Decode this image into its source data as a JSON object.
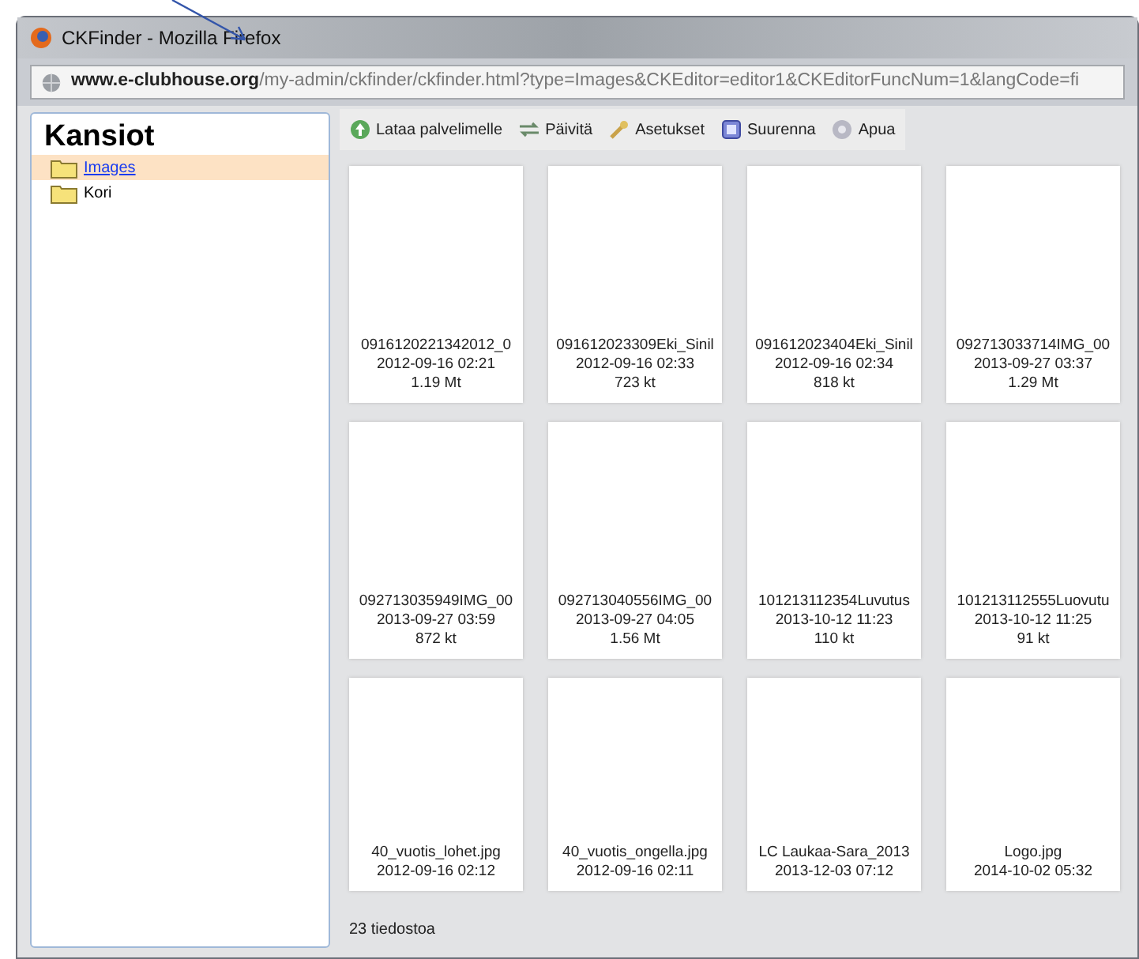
{
  "window": {
    "title": "CKFinder - Mozilla Firefox"
  },
  "address_bar": {
    "domain": "www.e-clubhouse.org",
    "path": "/my-admin/ckfinder/ckfinder.html?type=Images&CKEditor=editor1&CKEditorFuncNum=1&langCode=fi"
  },
  "sidebar": {
    "title": "Kansiot",
    "items": [
      {
        "label": "Images",
        "selected": true
      },
      {
        "label": "Kori",
        "selected": false
      }
    ]
  },
  "toolbar": [
    {
      "label": "Lataa palvelimelle",
      "kind": "upload"
    },
    {
      "label": "Päivitä",
      "kind": "refresh"
    },
    {
      "label": "Asetukset",
      "kind": "settings"
    },
    {
      "label": "Suurenna",
      "kind": "maximize"
    },
    {
      "label": "Apua",
      "kind": "help"
    }
  ],
  "files": [
    {
      "name": "0916120221342012_0",
      "date": "2012-09-16 02:21",
      "size": "1.19 Mt"
    },
    {
      "name": "091612023309Eki_Sinil",
      "date": "2012-09-16 02:33",
      "size": "723 kt"
    },
    {
      "name": "091612023404Eki_Sinil",
      "date": "2012-09-16 02:34",
      "size": "818 kt"
    },
    {
      "name": "092713033714IMG_00",
      "date": "2013-09-27 03:37",
      "size": "1.29 Mt"
    },
    {
      "name": "092713035949IMG_00",
      "date": "2013-09-27 03:59",
      "size": "872 kt"
    },
    {
      "name": "092713040556IMG_00",
      "date": "2013-09-27 04:05",
      "size": "1.56 Mt"
    },
    {
      "name": "101213112354Luvutus",
      "date": "2013-10-12 11:23",
      "size": "110 kt"
    },
    {
      "name": "101213112555Luovutu",
      "date": "2013-10-12 11:25",
      "size": "91 kt"
    },
    {
      "name": "40_vuotis_lohet.jpg",
      "date": "2012-09-16 02:12"
    },
    {
      "name": "40_vuotis_ongella.jpg",
      "date": "2012-09-16 02:11"
    },
    {
      "name": "LC Laukaa-Sara_2013",
      "date": "2013-12-03 07:12"
    },
    {
      "name": "Logo.jpg",
      "date": "2014-10-02 05:32"
    }
  ],
  "status_bar": "23 tiedostoa"
}
